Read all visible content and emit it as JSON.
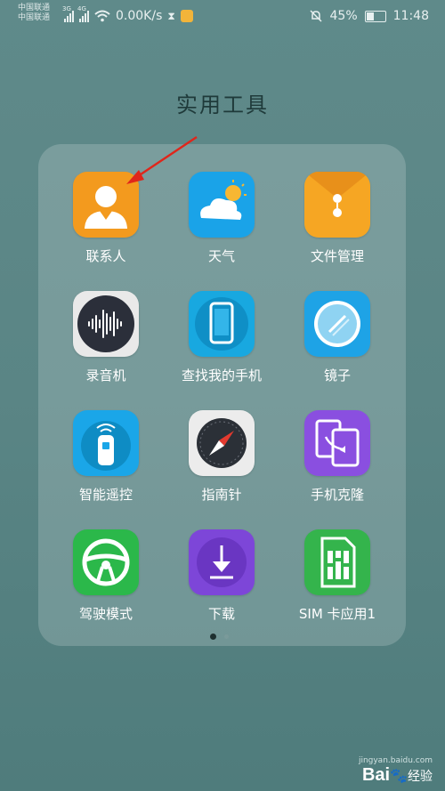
{
  "status_bar": {
    "carrier_line1": "中国联通",
    "carrier_line2": "中国联通",
    "net_speed": "0.00K/s",
    "battery_percent": "45%",
    "time": "11:48",
    "sig1_tag": "3G",
    "sig2_tag": "4G"
  },
  "folder": {
    "title": "实用工具",
    "page_index": 1,
    "page_count": 2
  },
  "apps": [
    {
      "label": "联系人",
      "icon": "contacts-icon",
      "color": "#f39a1e"
    },
    {
      "label": "天气",
      "icon": "weather-icon",
      "color": "#1aa3e8"
    },
    {
      "label": "文件管理",
      "icon": "file-manager-icon",
      "color": "#f6a623"
    },
    {
      "label": "录音机",
      "icon": "recorder-icon",
      "color": "#2b2f3a"
    },
    {
      "label": "查找我的手机",
      "icon": "find-my-phone-icon",
      "color": "#18a8e0"
    },
    {
      "label": "镜子",
      "icon": "mirror-icon",
      "color": "#1ea3e6"
    },
    {
      "label": "智能遥控",
      "icon": "smart-remote-icon",
      "color": "#1aa6e8"
    },
    {
      "label": "指南针",
      "icon": "compass-icon",
      "color": "#ececec"
    },
    {
      "label": "手机克隆",
      "icon": "phone-clone-icon",
      "color": "#8a4fe0"
    },
    {
      "label": "驾驶模式",
      "icon": "driving-mode-icon",
      "color": "#2bb84a"
    },
    {
      "label": "下载",
      "icon": "download-icon",
      "color": "#7d46d8"
    },
    {
      "label": "SIM 卡应用1",
      "icon": "sim-card-icon",
      "color": "#34b44c"
    }
  ],
  "watermark": {
    "url": "jingyan.baidu.com",
    "logo": "Bai",
    "logo2": "经验"
  }
}
